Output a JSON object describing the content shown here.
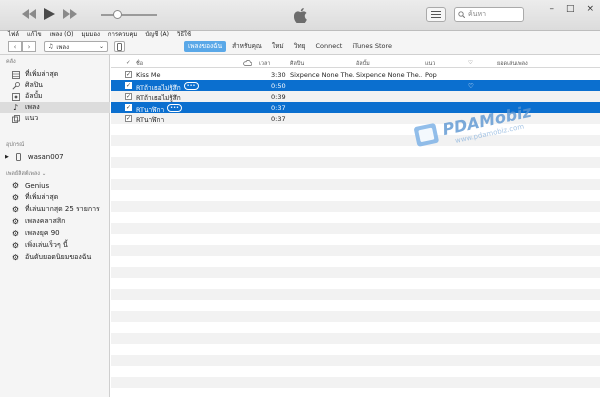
{
  "window": {
    "controls": [
      "–",
      "□",
      "×"
    ]
  },
  "search": {
    "placeholder": "ค้นหา"
  },
  "menu": [
    "ไฟล์",
    "แก้ไข",
    "เพลง (O)",
    "มุมมอง",
    "การควบคุม",
    "บัญชี (A)",
    "วิธีใช้"
  ],
  "toolbar": {
    "back": "‹",
    "forward": "›",
    "media_select": "เพลง",
    "tabs": [
      "เพลงของฉัน",
      "สำหรับคุณ",
      "ใหม่",
      "วิทยุ",
      "Connect",
      "iTunes Store"
    ],
    "active_tab": 0
  },
  "sidebar": {
    "library_header": "คลัง",
    "library_items": [
      "ที่เพิ่มล่าสุด",
      "ศิลปิน",
      "อัลบั้ม",
      "เพลง",
      "แนว"
    ],
    "selected_index": 3,
    "devices_header": "อุปกรณ์",
    "device_name": "wasan007",
    "playlists_header": "เพลย์ลิสต์เพลง ⌄",
    "playlists": [
      "Genius",
      "ที่เพิ่มล่าสุด",
      "ที่เล่นมากสุด 25 รายการ",
      "เพลงคลาสสิก",
      "เพลงยุค 90",
      "เพิ่งเล่นเร็วๆ นี้",
      "อันดับยอดนิยมของฉัน"
    ]
  },
  "columns": {
    "check": "✓",
    "name": "ชื่อ",
    "time": "เวลา",
    "artist": "ศิลปิน",
    "album": "อัลบั้ม",
    "genre": "แนว",
    "plays": "ยอดเล่นเพลง"
  },
  "tracks": [
    {
      "name": "Kiss Me",
      "time": "3:30",
      "artist": "Sixpence None The...",
      "album": "Sixpence None The...",
      "genre": "Pop",
      "selected": false,
      "badge": "",
      "heart": false
    },
    {
      "name": "RTถ้าเธอไม่รู้สึก",
      "time": "0:50",
      "artist": "",
      "album": "",
      "genre": "",
      "selected": true,
      "badge": "•••",
      "heart": true
    },
    {
      "name": "RTถ้าเธอไม่รู้สึก",
      "time": "0:39",
      "artist": "",
      "album": "",
      "genre": "",
      "selected": false,
      "badge": "",
      "heart": false
    },
    {
      "name": "RTนาฬิกา",
      "time": "0:37",
      "artist": "",
      "album": "",
      "genre": "",
      "selected": true,
      "badge": "•••",
      "heart": false
    },
    {
      "name": "RTนาฬิกา",
      "time": "0:37",
      "artist": "",
      "album": "",
      "genre": "",
      "selected": false,
      "badge": "",
      "heart": false
    }
  ],
  "watermark": {
    "brand": "PDAMobiz",
    "url": "www.pdamobiz.com"
  },
  "colors": {
    "selection": "#0b6fcf",
    "tab_active": "#5aa8e8"
  }
}
